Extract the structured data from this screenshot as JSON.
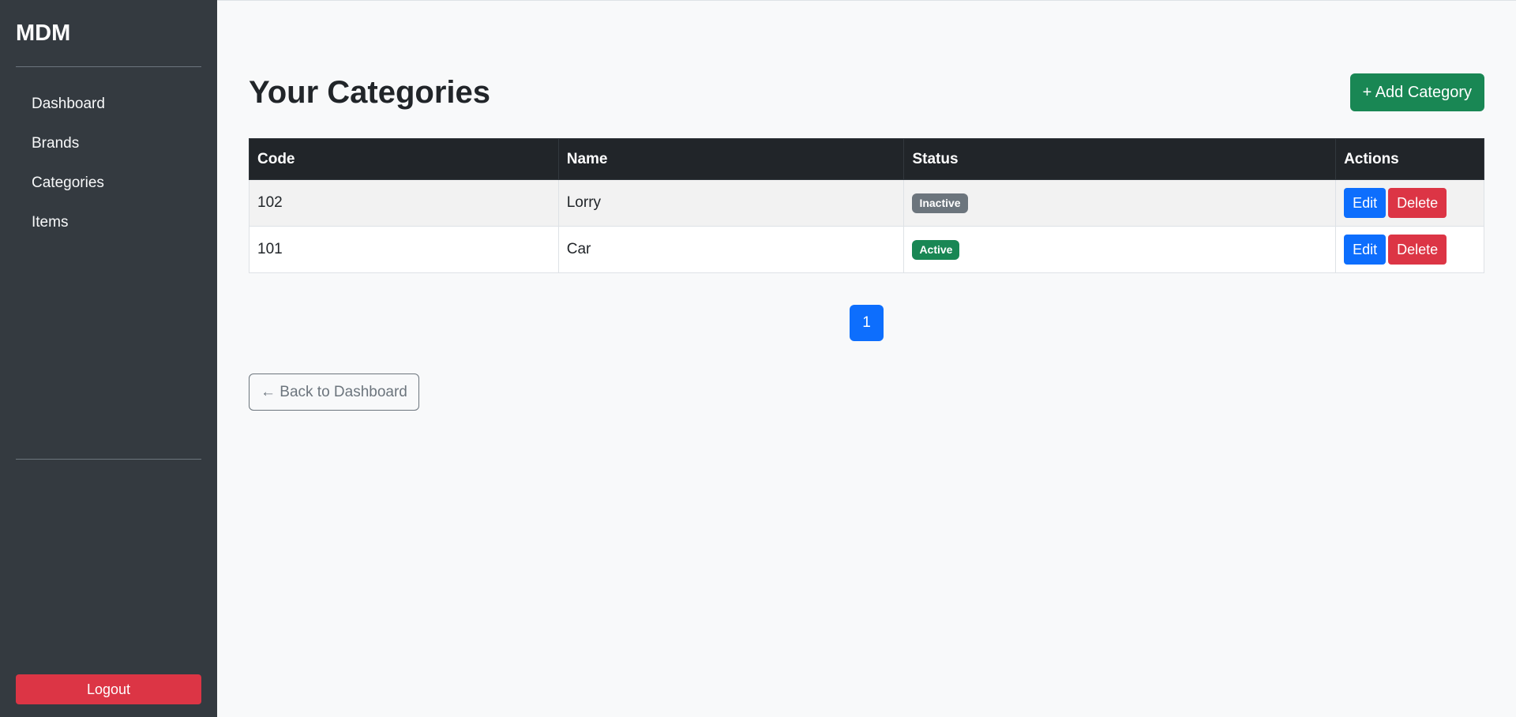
{
  "sidebar": {
    "brand": "MDM",
    "nav": [
      {
        "label": "Dashboard"
      },
      {
        "label": "Brands"
      },
      {
        "label": "Categories"
      },
      {
        "label": "Items"
      }
    ],
    "logout_label": "Logout"
  },
  "main": {
    "title": "Your Categories",
    "add_label": "+ Add Category",
    "table": {
      "headers": [
        "Code",
        "Name",
        "Status",
        "Actions"
      ],
      "rows": [
        {
          "code": "102",
          "name": "Lorry",
          "status": "Inactive",
          "edit": "Edit",
          "delete": "Delete"
        },
        {
          "code": "101",
          "name": "Car",
          "status": "Active",
          "edit": "Edit",
          "delete": "Delete"
        }
      ]
    },
    "pagination": {
      "current": "1"
    },
    "back_label": "← Back to Dashboard"
  },
  "colors": {
    "sidebar_bg": "#343a40",
    "success": "#198754",
    "primary": "#0d6efd",
    "danger": "#dc3545",
    "secondary": "#6c757d",
    "table_header_bg": "#212529"
  }
}
